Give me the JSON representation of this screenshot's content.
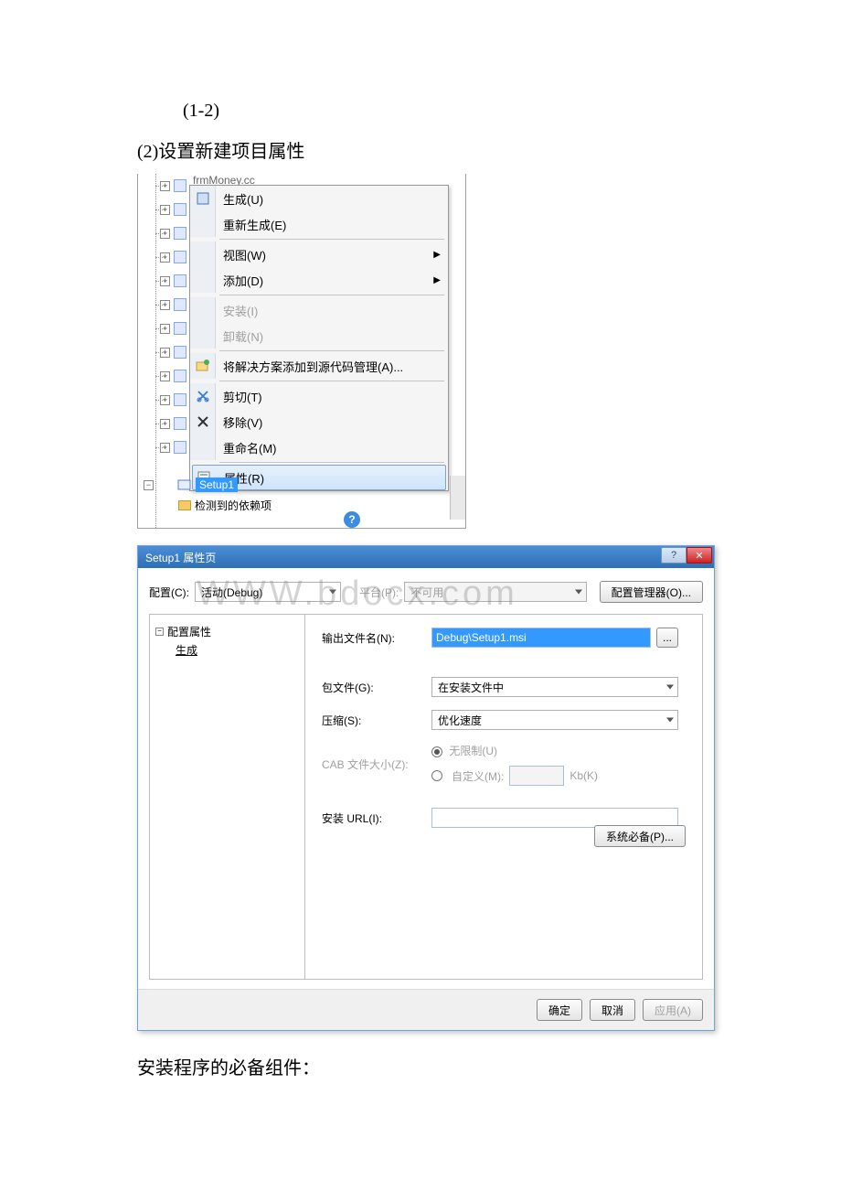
{
  "doc": {
    "caption_top": "(1-2)",
    "heading2": "(2)设置新建项目属性",
    "body_text": "安装程序的必备组件：",
    "watermark": "WWW.bdocx.com"
  },
  "tree": {
    "truncated": "frmMoney.cc",
    "selected_node": "Setup1",
    "deps_label": "检测到的依赖项",
    "minus": "−",
    "plus": "+"
  },
  "context_menu": {
    "build": "生成(U)",
    "rebuild": "重新生成(E)",
    "view": "视图(W)",
    "add": "添加(D)",
    "install": "安装(I)",
    "uninstall": "卸载(N)",
    "add_to_scc": "将解决方案添加到源代码管理(A)...",
    "cut": "剪切(T)",
    "remove": "移除(V)",
    "rename": "重命名(M)",
    "properties": "属性(R)"
  },
  "dialog": {
    "title": "Setup1 属性页",
    "help_glyph": "?",
    "close_glyph": "✕",
    "config_label": "配置(C):",
    "config_value": "活动(Debug)",
    "platform_label": "平台(P):",
    "platform_value": "不可用",
    "config_mgr_btn": "配置管理器(O)...",
    "tree_root": "配置属性",
    "tree_child": "生成",
    "output_label": "输出文件名(N):",
    "output_value": "Debug\\Setup1.msi",
    "browse_btn": "...",
    "package_label": "包文件(G):",
    "package_value": "在安装文件中",
    "compress_label": "压缩(S):",
    "compress_value": "优化速度",
    "cab_label": "CAB 文件大小(Z):",
    "cab_unlimited": "无限制(U)",
    "cab_custom": "自定义(M):",
    "cab_kb": "Kb(K)",
    "install_url_label": "安装 URL(I):",
    "prereq_btn": "系统必备(P)...",
    "ok": "确定",
    "cancel": "取消",
    "apply": "应用(A)"
  }
}
